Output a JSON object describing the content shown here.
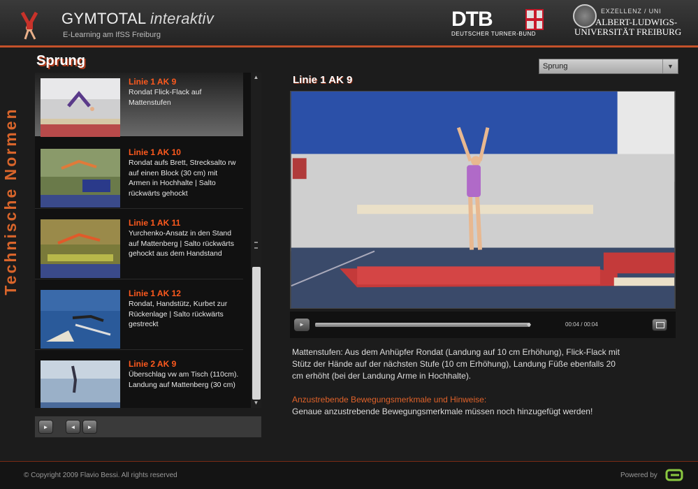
{
  "header": {
    "title_main": "GYMTOTAL",
    "title_italic": "interaktiv",
    "subtitle": "E-Learning am IfSS Freiburg",
    "dtb_word": "DTB",
    "dtb_sub": "DEUTSCHER TURNER-BUND",
    "uni_excellence": "EXZELLENZ / UNI",
    "uni_name_line1": "ALBERT-LUDWIGS-",
    "uni_name_line2": "UNIVERSITÄT FREIBURG"
  },
  "sidebar": {
    "vertical_label": "Technische Normen",
    "section_title": "Sprung"
  },
  "list": {
    "items": [
      {
        "title": "Linie 1 AK 9",
        "desc": "Rondat Flick-Flack auf Mattenstufen",
        "selected": true
      },
      {
        "title": "Linie 1 AK 10",
        "desc": "Rondat aufs Brett, Strecksalto rw auf einen Block (30 cm) mit Armen in Hochhalte | Salto rückwärts gehockt",
        "selected": false
      },
      {
        "title": "Linie 1 AK 11",
        "desc": "Yurchenko-Ansatz in den Stand auf Mattenberg | Salto rückwärts gehockt aus dem Handstand",
        "selected": false
      },
      {
        "title": "Linie 1 AK 12",
        "desc": "Rondat, Handstütz, Kurbet zur Rückenlage | Salto rückwärts gestreckt",
        "selected": false
      },
      {
        "title": "Linie 2 AK 9",
        "desc": "Überschlag vw am Tisch (110cm). Landung auf Mattenberg (30 cm)",
        "selected": false
      }
    ]
  },
  "dropdown": {
    "value": "Sprung"
  },
  "video": {
    "title": "Linie 1 AK 9",
    "time": "00:04 / 00:04",
    "progress": 1.0
  },
  "main": {
    "description": "Mattenstufen: Aus dem Anhüpfer Rondat (Landung auf 10 cm Erhöhung), Flick-Flack mit Stütz der Hände auf der nächsten Stufe (10 cm Erhöhung), Landung Füße ebenfalls 20 cm erhöht (bei der Landung Arme in Hochhalte).",
    "hint_title": "Anzustrebende Bewegungsmerkmale und Hinweise:",
    "hint_text": "Genaue anzustrebende Bewegungsmerkmale müssen noch hinzugefügt werden!"
  },
  "footer": {
    "copyright": "© Copyright 2009 Flavio Bessi. All rights reserved",
    "powered_by": "Powered by"
  },
  "icons": {
    "play": "play-icon",
    "prev": "previous-icon",
    "next": "next-icon",
    "fullscreen": "fullscreen-icon"
  },
  "colors": {
    "accent": "#d9652b",
    "item_title": "#ff5a1e"
  }
}
